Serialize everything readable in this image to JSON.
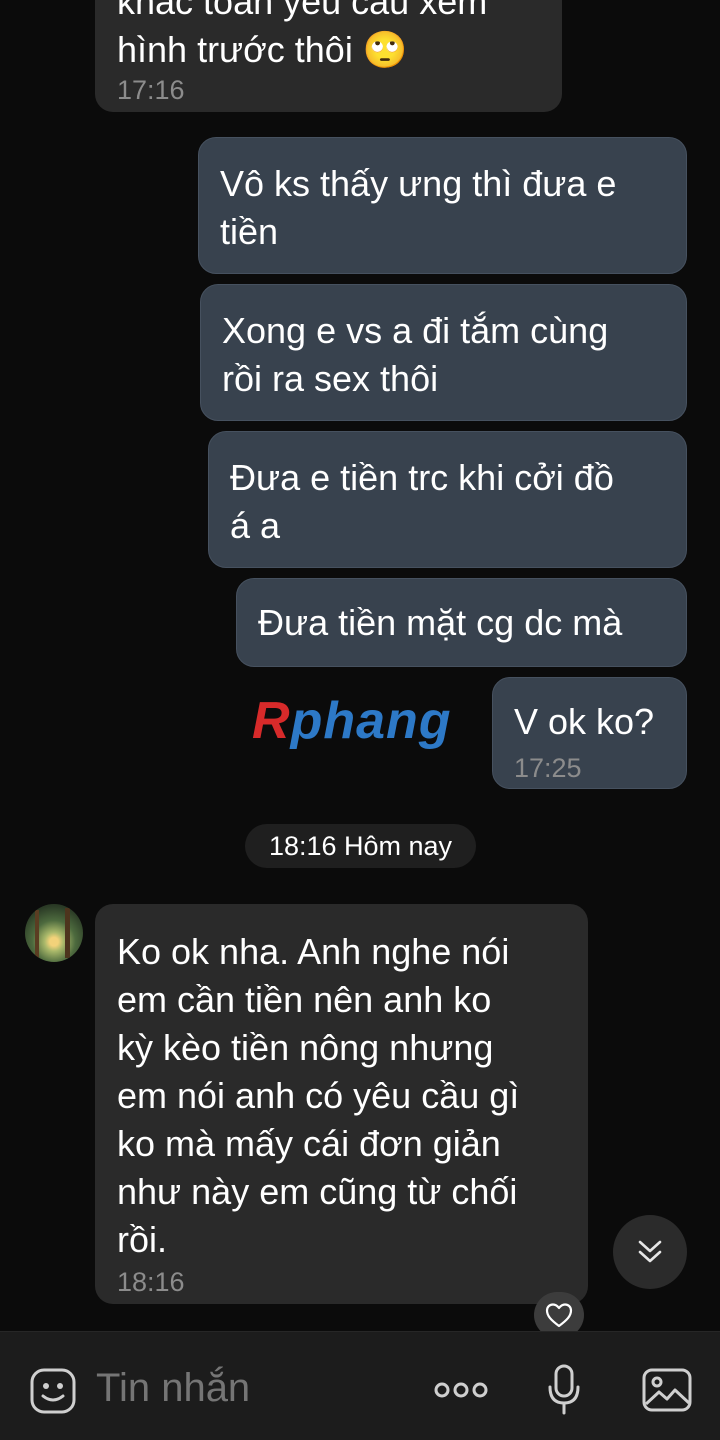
{
  "messages": [
    {
      "type": "received",
      "text": "khác toàn yêu cầu xem\nhình trước thôi 🙄",
      "time": "17:16"
    },
    {
      "type": "sent",
      "text": "Vô ks thấy ưng thì đưa e\ntiền"
    },
    {
      "type": "sent",
      "text": "Xong e vs a đi tắm cùng\nrồi ra sex thôi"
    },
    {
      "type": "sent",
      "text": "Đưa e tiền trc khi cởi đồ\ná a"
    },
    {
      "type": "sent",
      "text": "Đưa tiền mặt cg dc mà"
    },
    {
      "type": "sent",
      "text": "V ok ko?",
      "time": "17:25"
    },
    {
      "type": "received",
      "text": "Ko ok nha. Anh nghe nói\nem cần tiền nên anh ko\nkỳ kèo tiền nông nhưng\nem nói anh có yêu cầu gì\nko mà mấy cái đơn giản\nnhư này em cũng từ chối\nrồi.",
      "time": "18:16"
    }
  ],
  "date_separator": "18:16 Hôm nay",
  "watermark": {
    "part1": "R",
    "part2": "phang"
  },
  "composer": {
    "placeholder": "Tin nhắn"
  },
  "icons": {
    "emoji": "emoji-icon",
    "more": "more-dots-icon",
    "mic": "microphone-icon",
    "gallery": "gallery-icon",
    "scroll_down": "double-chevron-down-icon",
    "react": "heart-icon",
    "avatar": "avatar-forest"
  },
  "colors": {
    "background": "#0b0b0b",
    "received_bubble": "#2a2a2a",
    "sent_bubble": "#38424e",
    "timestamp": "#8c8c8c"
  }
}
